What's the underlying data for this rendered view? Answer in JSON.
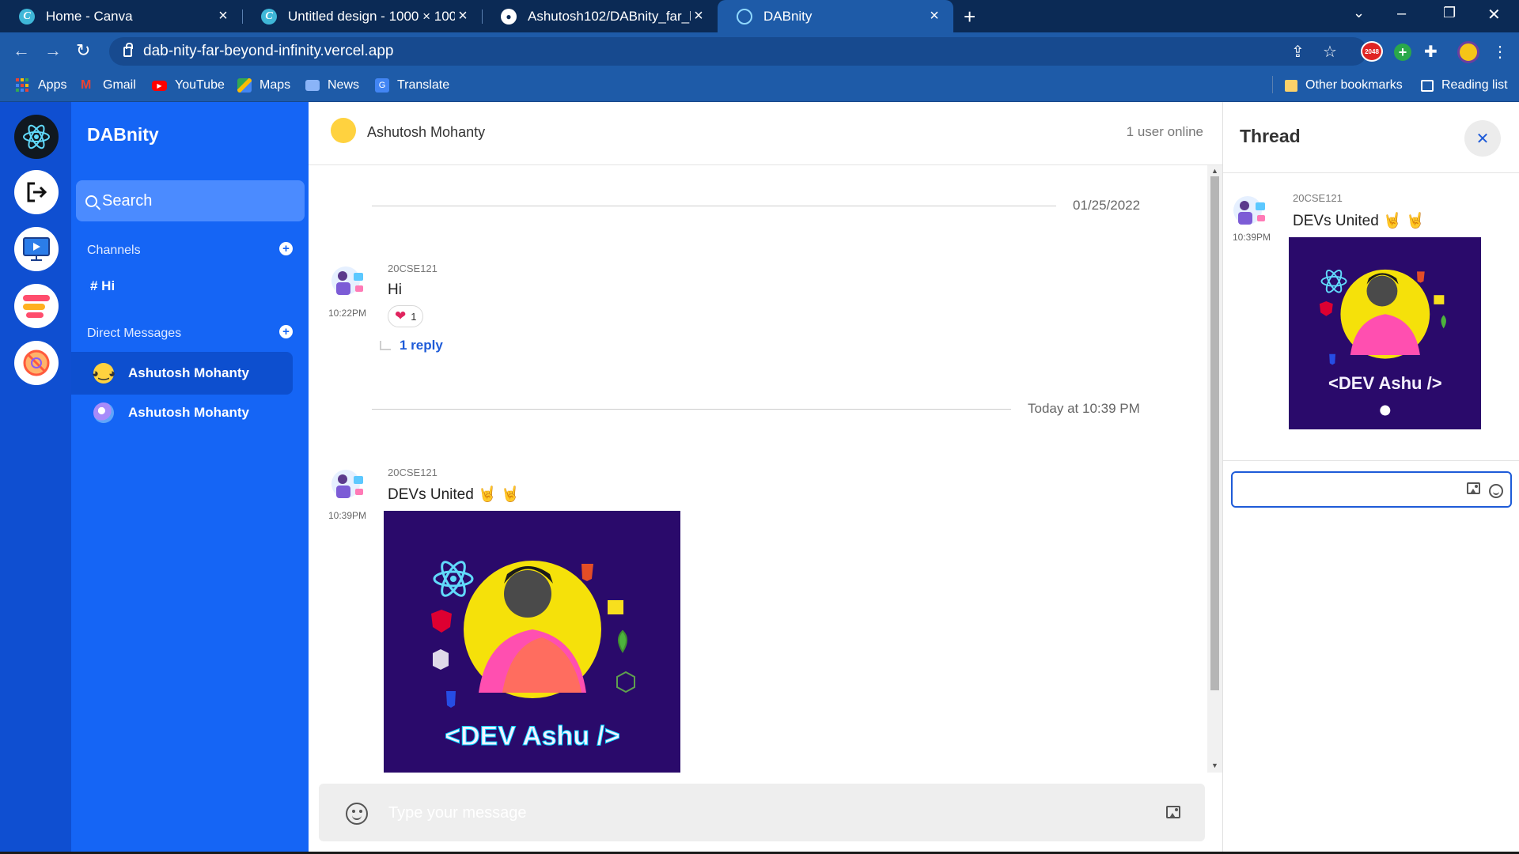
{
  "browser": {
    "tabs": [
      {
        "title": "Home - Canva",
        "favicon": "canva-icon",
        "active": false
      },
      {
        "title": "Untitled design - 1000 × 1000px",
        "favicon": "canva-icon",
        "active": false
      },
      {
        "title": "Ashutosh102/DABnity_far_beyond",
        "favicon": "github-icon",
        "active": false
      },
      {
        "title": "DABnity",
        "favicon": "react-icon",
        "active": true
      }
    ],
    "url": "dab-nity-far-beyond-infinity.vercel.app",
    "bookmarks": [
      {
        "label": "Apps",
        "icon": "apps-grid-icon"
      },
      {
        "label": "Gmail",
        "icon": "gmail-icon"
      },
      {
        "label": "YouTube",
        "icon": "youtube-icon"
      },
      {
        "label": "Maps",
        "icon": "maps-icon"
      },
      {
        "label": "News",
        "icon": "news-icon"
      },
      {
        "label": "Translate",
        "icon": "translate-icon"
      }
    ],
    "other_bookmarks": "Other bookmarks",
    "reading_list": "Reading list",
    "extension_badge": "2048"
  },
  "sidebar": {
    "brand": "DABnity",
    "search_label": "Search",
    "channels_label": "Channels",
    "channels": [
      "# Hi"
    ],
    "dm_label": "Direct Messages",
    "dms": [
      {
        "name": "Ashutosh Mohanty",
        "avatar": "pikachu-avatar",
        "active": true
      },
      {
        "name": "Ashutosh Mohanty",
        "avatar": "profile-avatar",
        "active": false
      }
    ]
  },
  "chat": {
    "header_name": "Ashutosh Mohanty",
    "online_status": "1 user online",
    "date_1": "01/25/2022",
    "date_2": "Today at 10:39 PM",
    "messages": [
      {
        "user": "20CSE121",
        "time": "10:22PM",
        "text": "Hi",
        "reaction_count": "1",
        "reply_label": "1 reply"
      },
      {
        "user": "20CSE121",
        "time": "10:39PM",
        "text": "DEVs United 🤘 🤘"
      }
    ],
    "composer_placeholder": "Type your message"
  },
  "poster": {
    "tagline": "<DEV Ashu />",
    "badges": {
      "html": "5",
      "js": "JS",
      "angular": "A",
      "hexo": "H",
      "css": "3",
      "node": "JS"
    }
  },
  "thread": {
    "title": "Thread",
    "message": {
      "user": "20CSE121",
      "time": "10:39PM",
      "text": "DEVs United 🤘 🤘"
    }
  },
  "colors": {
    "rail": "#0f4fd1",
    "sidebar": "#1565f5",
    "accent": "#1e5bd8",
    "chrome_tabstrip": "#0b2a55",
    "chrome_toolbar": "#1e5ba8"
  }
}
